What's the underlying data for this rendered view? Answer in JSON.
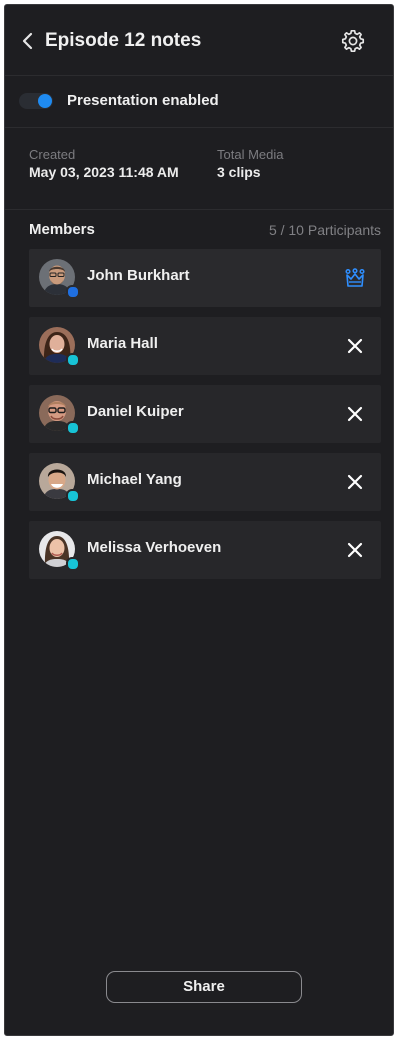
{
  "header": {
    "title": "Episode 12 notes"
  },
  "presentation": {
    "label": "Presentation enabled",
    "enabled": true,
    "accent": "#1f8bf1"
  },
  "info": {
    "created_label": "Created",
    "created_value": "May 03, 2023 11:48 AM",
    "media_label": "Total Media",
    "media_value": "3 clips"
  },
  "members": {
    "label": "Members",
    "count": "5 / 10 Participants",
    "items": [
      {
        "name": "John Burkhart",
        "role": "owner",
        "status_color": "#1f6fe0",
        "action_icon": "crown-icon"
      },
      {
        "name": "Maria Hall",
        "role": "member",
        "status_color": "#17c3d6",
        "action_icon": "close-icon"
      },
      {
        "name": "Daniel Kuiper",
        "role": "member",
        "status_color": "#17c3d6",
        "action_icon": "close-icon"
      },
      {
        "name": "Michael Yang",
        "role": "member",
        "status_color": "#17c3d6",
        "action_icon": "close-icon"
      },
      {
        "name": "Melissa Verhoeven",
        "role": "member",
        "status_color": "#17c3d6",
        "action_icon": "close-icon"
      }
    ]
  },
  "footer": {
    "share_label": "Share"
  }
}
